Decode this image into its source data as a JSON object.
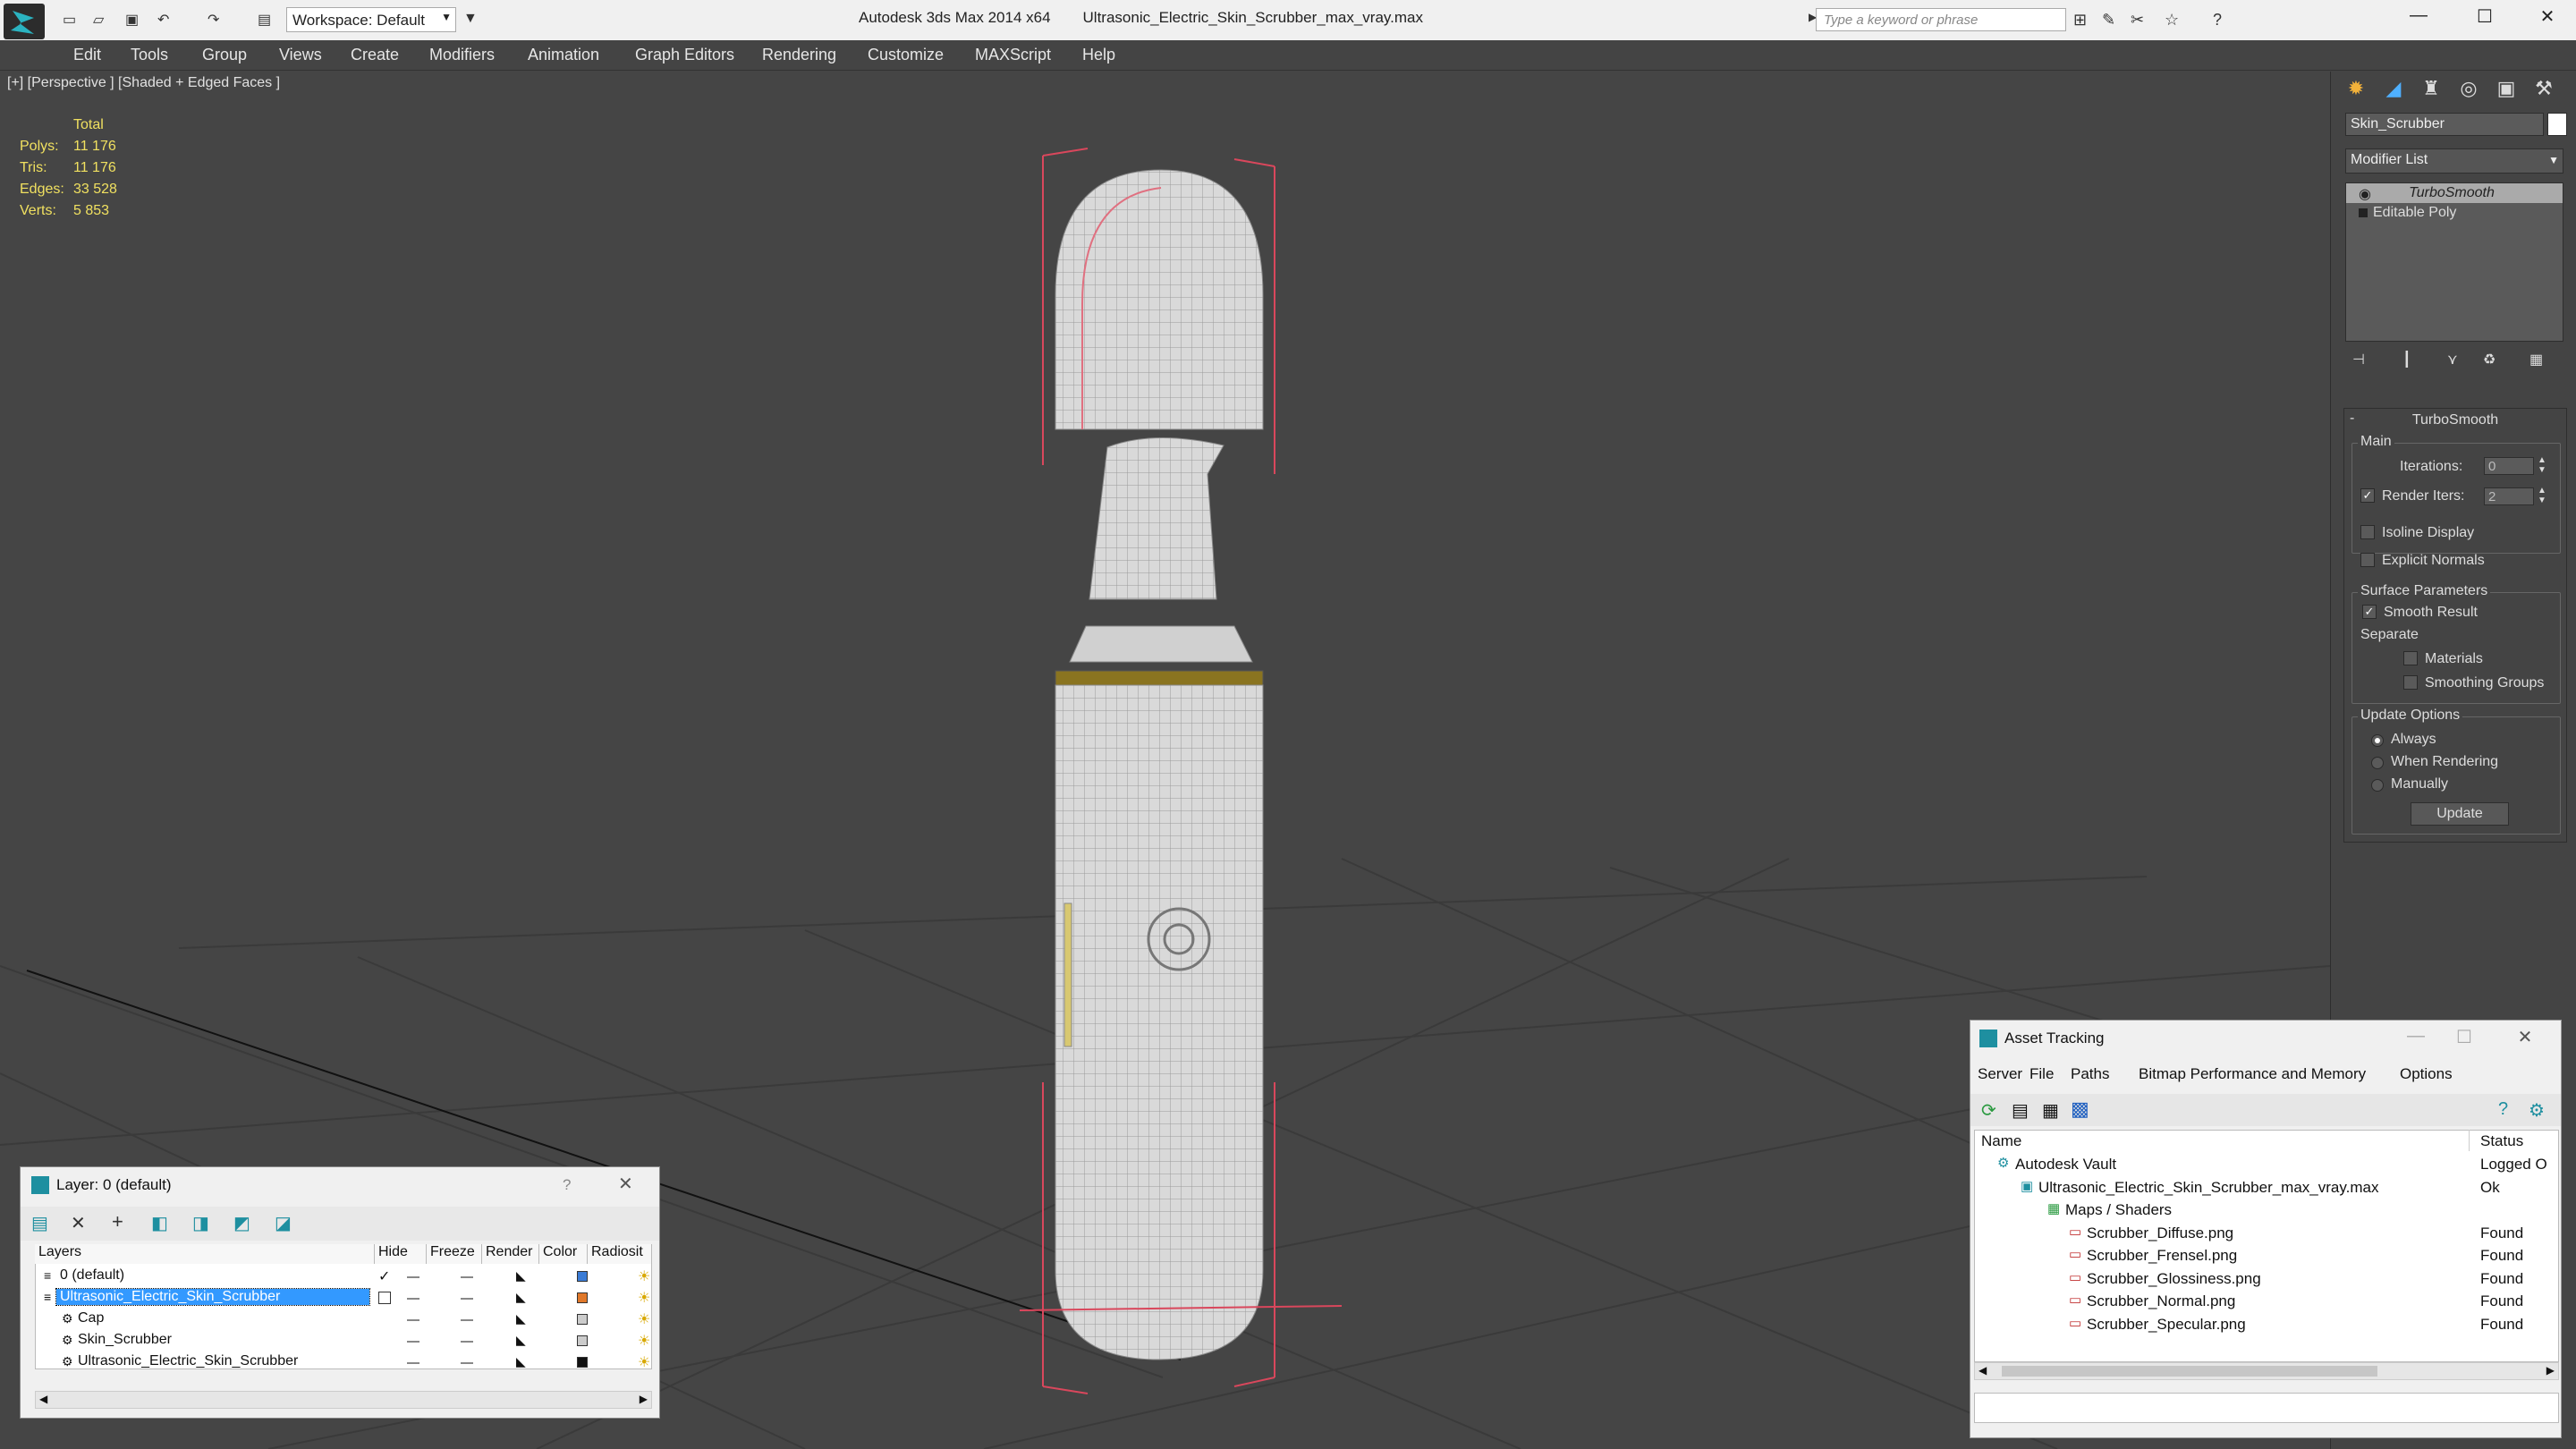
{
  "app": {
    "title": "Autodesk 3ds Max 2014 x64",
    "filename": "Ultrasonic_Electric_Skin_Scrubber_max_vray.max",
    "workspace": "Workspace: Default",
    "search_placeholder": "Type a keyword or phrase"
  },
  "menu": [
    "Edit",
    "Tools",
    "Group",
    "Views",
    "Create",
    "Modifiers",
    "Animation",
    "Graph Editors",
    "Rendering",
    "Customize",
    "MAXScript",
    "Help"
  ],
  "viewport": {
    "label": "[+] [Perspective ] [Shaded + Edged Faces ]",
    "stats": {
      "header": "Total",
      "rows": [
        {
          "label": "Polys:",
          "value": "11 176"
        },
        {
          "label": "Tris:",
          "value": "11 176"
        },
        {
          "label": "Edges:",
          "value": "33 528"
        },
        {
          "label": "Verts:",
          "value": "5 853"
        }
      ]
    }
  },
  "command_panel": {
    "object_name": "Skin_Scrubber",
    "modifier_list": "Modifier List",
    "stack": [
      "TurboSmooth",
      "Editable Poly"
    ],
    "rollout_title": "TurboSmooth",
    "main_group": "Main",
    "iterations_label": "Iterations:",
    "iterations_value": "0",
    "render_iters_label": "Render Iters:",
    "render_iters_value": "2",
    "isoline_label": "Isoline Display",
    "explicit_normals_label": "Explicit Normals",
    "surface_group": "Surface Parameters",
    "smooth_result_label": "Smooth Result",
    "separate_label": "Separate",
    "materials_label": "Materials",
    "smoothing_groups_label": "Smoothing Groups",
    "update_group": "Update Options",
    "always_label": "Always",
    "when_rendering_label": "When Rendering",
    "manually_label": "Manually",
    "update_button": "Update",
    "render_iters_checked": true,
    "smooth_result_checked": true,
    "update_mode": "Always"
  },
  "layer_window": {
    "title": "Layer: 0 (default)",
    "help": "?",
    "columns": [
      "Layers",
      "Hide",
      "Freeze",
      "Render",
      "Color",
      "Radiosit"
    ],
    "rows": [
      {
        "name": "0 (default)",
        "color": "#3a7bd5",
        "selected": false
      },
      {
        "name": "Ultrasonic_Electric_Skin_Scrubber",
        "color": "#e0782a",
        "selected": true
      },
      {
        "name": "Cap",
        "color": "#cccccc",
        "selected": false
      },
      {
        "name": "Skin_Scrubber",
        "color": "#cccccc",
        "selected": false
      },
      {
        "name": "Ultrasonic_Electric_Skin_Scrubber",
        "color": "#111111",
        "selected": false
      }
    ]
  },
  "asset_tracking": {
    "title": "Asset Tracking",
    "menu": [
      "Server",
      "File",
      "Paths",
      "Bitmap Performance and Memory",
      "Options"
    ],
    "col_name": "Name",
    "col_status": "Status",
    "rows": [
      {
        "name": "Autodesk Vault",
        "status": "Logged O"
      },
      {
        "name": "Ultrasonic_Electric_Skin_Scrubber_max_vray.max",
        "status": "Ok"
      },
      {
        "name": "Maps / Shaders",
        "status": ""
      },
      {
        "name": "Scrubber_Diffuse.png",
        "status": "Found"
      },
      {
        "name": "Scrubber_Frensel.png",
        "status": "Found"
      },
      {
        "name": "Scrubber_Glossiness.png",
        "status": "Found"
      },
      {
        "name": "Scrubber_Normal.png",
        "status": "Found"
      },
      {
        "name": "Scrubber_Specular.png",
        "status": "Found"
      }
    ]
  },
  "colors": {
    "viewport_bg": "#454545",
    "stats_yellow": "#f0e060",
    "selection_blue": "#3399ff",
    "bbox_red": "#d9475c"
  }
}
